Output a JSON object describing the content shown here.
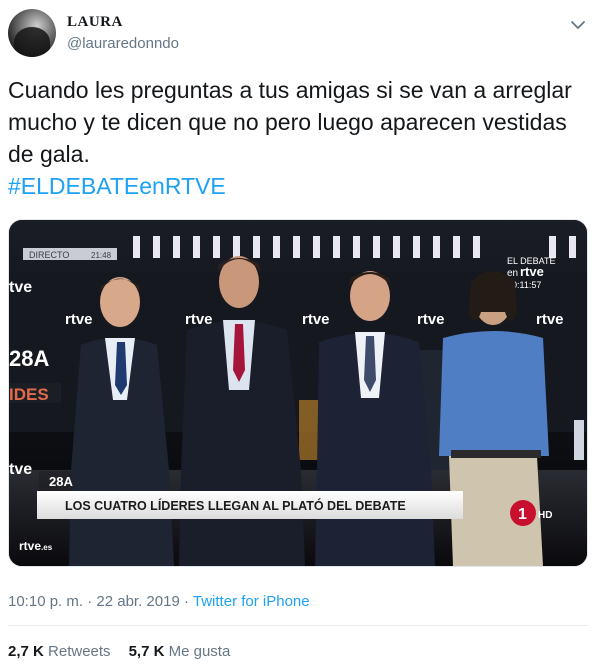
{
  "user": {
    "display_name": "LAURA",
    "handle": "@lauraredonndo"
  },
  "tweet": {
    "text_line1": "Cuando les preguntas a tus amigas si se van a arreglar",
    "text_line2": "mucho y te dicen que no pero luego aparecen vestidas",
    "text_line3": "de gala.",
    "hashtag": "#ELDEBATEenRTVE"
  },
  "media": {
    "live_label": "DIRECTO",
    "live_time": "21:48",
    "corner_title_line1": "EL DEBATE",
    "corner_title_line2": "en",
    "corner_brand": "rtve",
    "corner_timer": "00:11:57",
    "brand_repeat": "rtve",
    "left_edge_brand": "tve",
    "left_28a": "28A",
    "left_ides": "IDES",
    "lower_third_small": "28A",
    "lower_third_headline": "LOS CUATRO LÍDERES LLEGAN AL PLATÓ DEL DEBATE",
    "channel_number": "1",
    "channel_hd": "HD",
    "bottom_logo": "rtve",
    "bottom_logo_suffix": ".es"
  },
  "meta": {
    "time": "10:10 p. m.",
    "separator": "·",
    "date": "22 abr. 2019",
    "source": "Twitter for iPhone"
  },
  "stats": {
    "retweets_count": "2,7 K",
    "retweets_label": "Retweets",
    "likes_count": "5,7 K",
    "likes_label": "Me gusta"
  },
  "colors": {
    "link": "#1da1f2",
    "secondary_text": "#657786",
    "primary_text": "#14171a",
    "tve_red": "#c8102e"
  }
}
